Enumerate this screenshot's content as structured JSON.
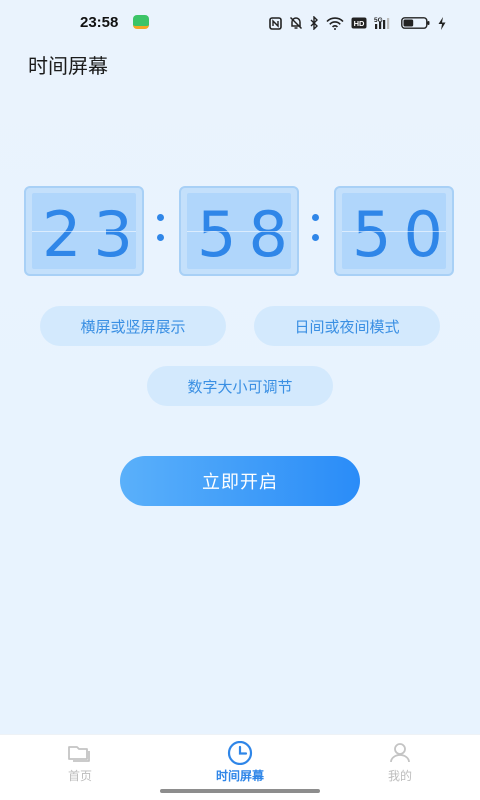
{
  "status_bar": {
    "time": "23:58",
    "icons": [
      "nfc-icon",
      "mute-bell-icon",
      "bluetooth-icon",
      "wifi-icon",
      "hd-icon",
      "5g-signal-icon",
      "battery-icon",
      "charging-icon"
    ],
    "network_label": "5G",
    "hd_label": "HD",
    "battery_level": 0.45
  },
  "header": {
    "title": "时间屏幕"
  },
  "clock": {
    "hours": "23",
    "minutes": "58",
    "seconds": "50",
    "digit_color": "#2f86e8"
  },
  "features": [
    {
      "label": "横屏或竖屏展示"
    },
    {
      "label": "日间或夜间模式"
    },
    {
      "label": "数字大小可调节"
    }
  ],
  "cta": {
    "label": "立即开启"
  },
  "bottom_nav": {
    "items": [
      {
        "label": "首页",
        "icon": "home-screens-icon",
        "active": false
      },
      {
        "label": "时间屏幕",
        "icon": "clock-icon",
        "active": true
      },
      {
        "label": "我的",
        "icon": "user-icon",
        "active": false
      }
    ]
  },
  "colors": {
    "accent": "#2f86e8",
    "pill_bg": "#d3e9fd",
    "background": "#eaf3fd"
  }
}
